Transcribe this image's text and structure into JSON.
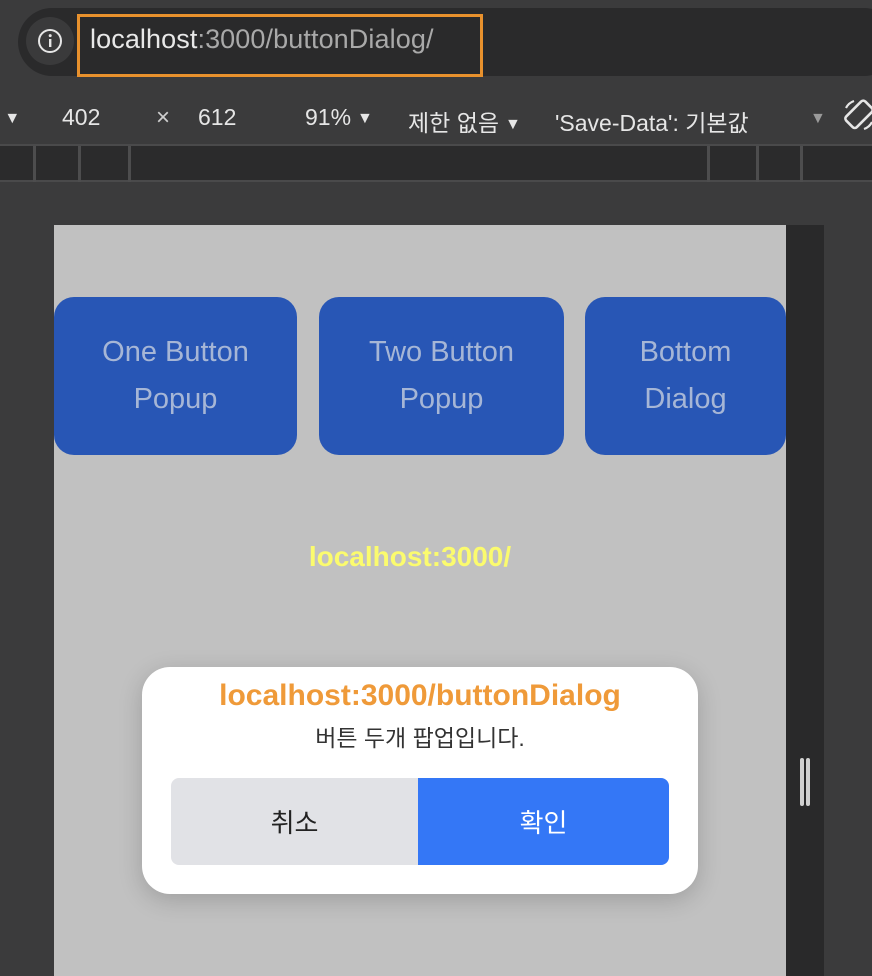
{
  "address_bar": {
    "url_host": "localhost",
    "url_rest": ":3000/buttonDialog/",
    "info_icon": "info-icon"
  },
  "device_toolbar": {
    "dimension_dropdown_icon": "chevron-down-icon",
    "width": "402",
    "times": "×",
    "height": "612",
    "zoom": "91%",
    "throttle": "제한 없음",
    "save_data": "'Save-Data': 기본값",
    "rotate_icon": "rotate-icon"
  },
  "page": {
    "buttons": [
      {
        "label": "One Button Popup"
      },
      {
        "label": "Two Button Popup"
      },
      {
        "label": "Bottom Dialog"
      }
    ],
    "home_link": "localhost:3000/"
  },
  "dialog": {
    "title": "localhost:3000/buttonDialog",
    "message": "버튼 두개 팝업입니다.",
    "cancel_label": "취소",
    "confirm_label": "확인"
  },
  "colors": {
    "highlight": "#e8912d",
    "nav_button": "#2856b5",
    "home_link": "#fbfb6e",
    "dialog_title": "#ef9a39",
    "confirm": "#3477f6"
  }
}
